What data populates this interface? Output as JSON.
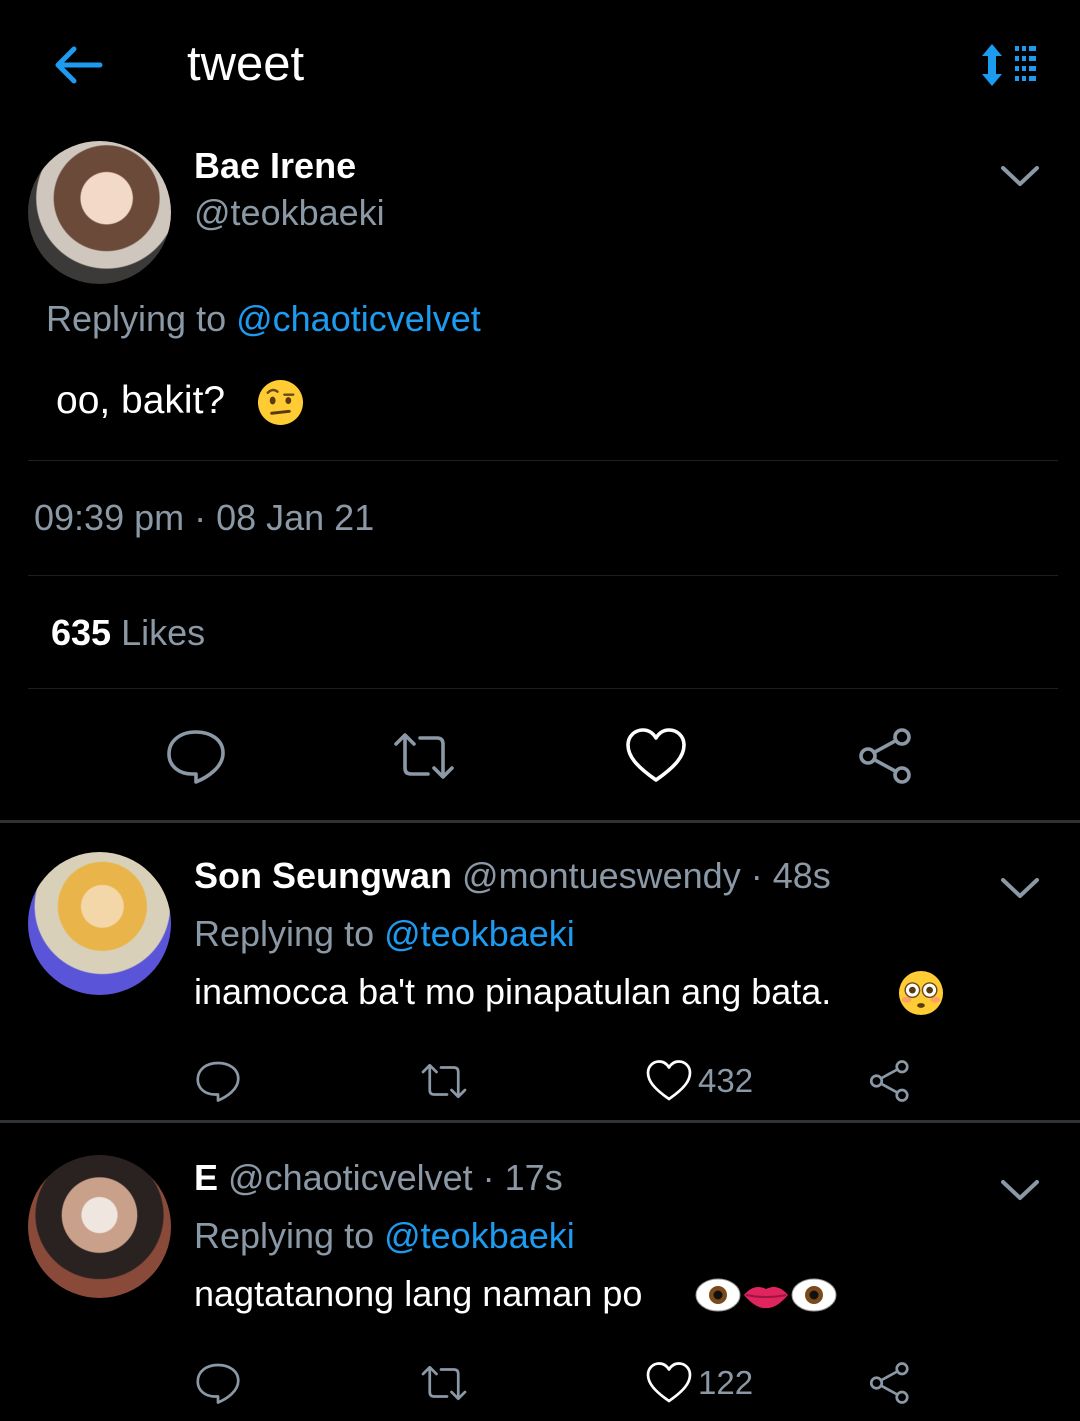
{
  "header": {
    "title": "tweet",
    "back_icon": "arrow-left-icon",
    "sort_icon": "sort-list-icon"
  },
  "main_tweet": {
    "name": "Bae Irene",
    "handle": "@teokbaeki",
    "replying_prefix": "Replying to ",
    "replying_to": "@chaoticvelvet",
    "text": "oo, bakit?",
    "emoji": "face-with-raised-eyebrow",
    "timestamp": "09:39 pm · 08 Jan 21",
    "likes_count": "635",
    "likes_label": " Likes"
  },
  "replies": [
    {
      "name": "Son Seungwan",
      "meta": " @montueswendy · 48s",
      "replying_prefix": "Replying to ",
      "replying_to": "@teokbaeki",
      "text": "inamocca ba't mo pinapatulan ang bata.",
      "emoji": "flushed-face",
      "like_count": "432"
    },
    {
      "name": "E",
      "meta": " @chaoticvelvet · 17s",
      "replying_prefix": "Replying to ",
      "replying_to": "@teokbaeki",
      "text": "nagtatanong lang naman po",
      "emoji": "eyes-lips-eyes",
      "like_count": "122"
    }
  ],
  "colors": {
    "accent": "#1d9bf0",
    "secondary_text": "#8b98a5",
    "background": "#000000",
    "divider": "#2f3336"
  }
}
